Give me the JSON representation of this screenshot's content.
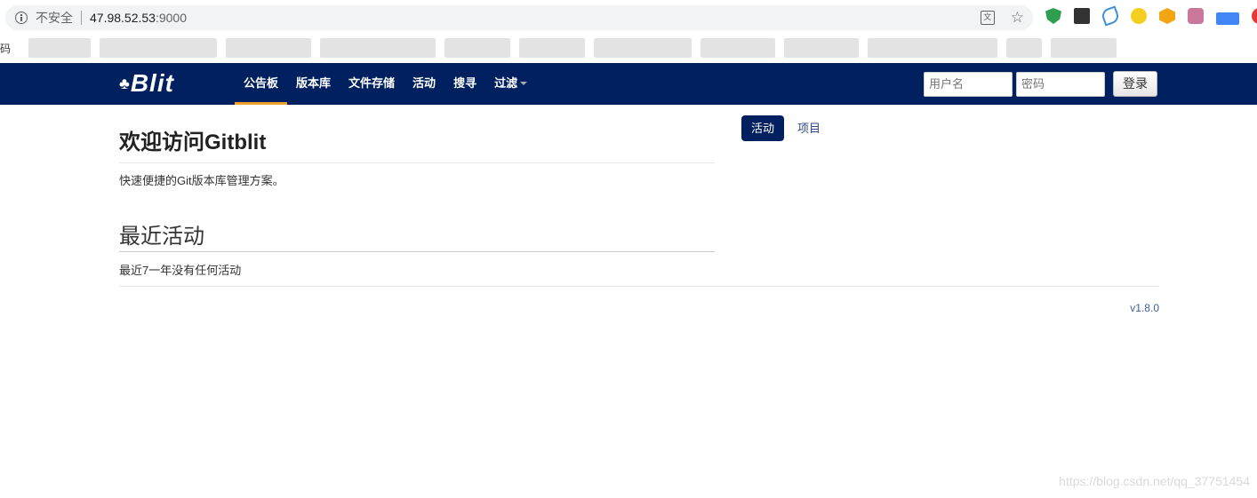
{
  "browser": {
    "insecure_label": "不安全",
    "url_host": "47.98.52.53",
    "url_port": ":9000",
    "bookmark_label": "码"
  },
  "navbar": {
    "brand_mark": "♣",
    "brand_text": "Blit",
    "items": [
      {
        "label": "公告板",
        "active": true
      },
      {
        "label": "版本库"
      },
      {
        "label": "文件存储"
      },
      {
        "label": "活动"
      },
      {
        "label": "搜寻"
      },
      {
        "label": "过滤"
      }
    ],
    "username_placeholder": "用户名",
    "password_placeholder": "密码",
    "login_label": "登录"
  },
  "main": {
    "title": "欢迎访问Gitblit",
    "tagline": "快速便捷的Git版本库管理方案。",
    "activity_title": "最近活动",
    "activity_text": "最近7一年没有任何活动"
  },
  "side_tabs": [
    {
      "label": "活动",
      "active": true
    },
    {
      "label": "项目"
    }
  ],
  "footer": {
    "version": "v1.8.0"
  },
  "watermark": "https://blog.csdn.net/qq_37751454",
  "colors": {
    "navbar_bg": "#002060",
    "active_underline": "#f0a030",
    "link": "#3a5f9e"
  }
}
